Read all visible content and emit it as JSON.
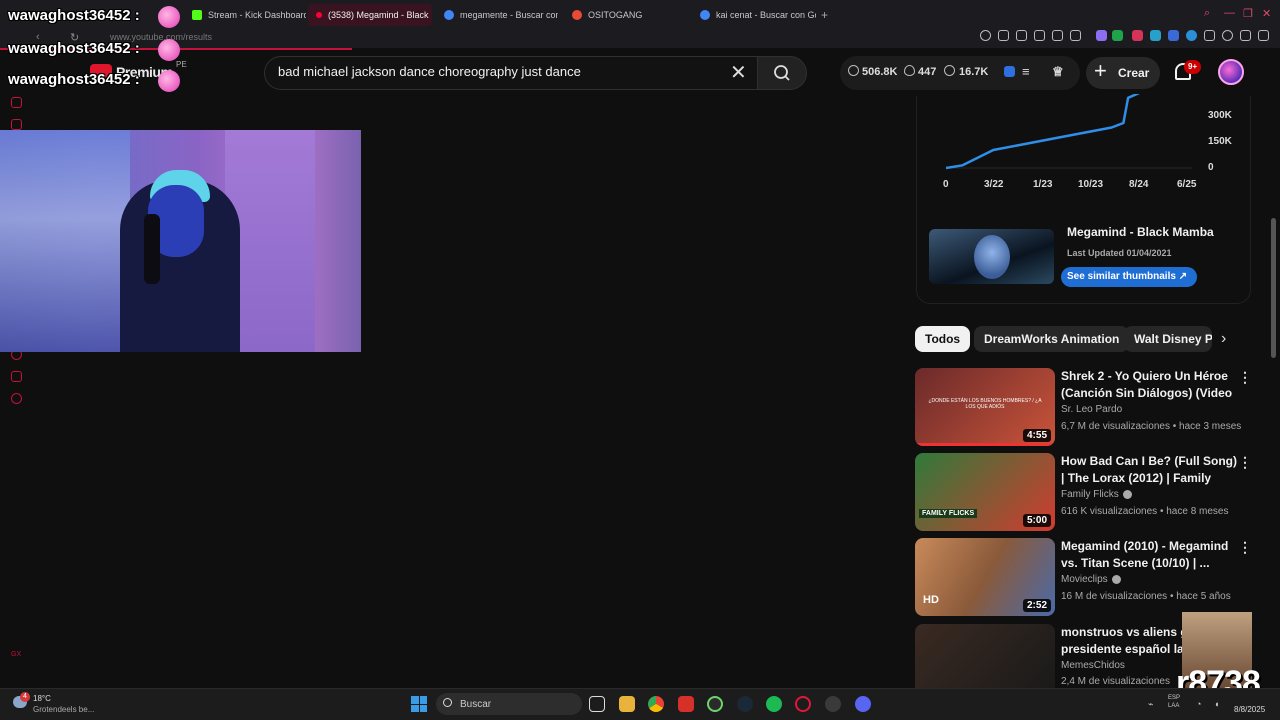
{
  "browser": {
    "tabs": [
      {
        "label": "",
        "favicon_color": "#5b5b5b"
      },
      {
        "label": "Stream - Kick Dashboard",
        "favicon_color": "#53fc18"
      },
      {
        "label": "(3538) Megamind - Black",
        "favicon_color": "#ff0033",
        "active": true
      },
      {
        "label": "megamente - Buscar con",
        "favicon_color": "#4285f4"
      },
      {
        "label": "OSITOGANG",
        "favicon_color": "#e84a3a"
      },
      {
        "label": "kai cenat - Buscar con Go",
        "favicon_color": "#4285f4"
      }
    ],
    "url": "www.youtube.com/results"
  },
  "youtube": {
    "logo_text": "Premium",
    "logo_sup": "PE",
    "search_query": "bad michael jackson dance choreography just dance",
    "stats": {
      "views": "506.8K",
      "likes": "447",
      "watch": "16.7K"
    },
    "create_label": "Crear",
    "notifications_badge": "9+"
  },
  "chat": [
    {
      "user": "wawaghost36452 :"
    },
    {
      "user": "wawaghost36452 :"
    },
    {
      "user": "wawaghost36452 :"
    }
  ],
  "chart_data": {
    "type": "line",
    "x_tick_labels": [
      "0",
      "3/22",
      "1/23",
      "10/23",
      "8/24",
      "6/25"
    ],
    "y_tick_labels": [
      "300K",
      "150K",
      "0"
    ],
    "ylim": [
      0,
      400000
    ],
    "series": [
      {
        "x": [
          0,
          0.35,
          1,
          1.6,
          2.4,
          3,
          3.5,
          3.75,
          3.85,
          4.2,
          4.6,
          5,
          5.2
        ],
        "values": [
          0,
          15000,
          100000,
          130000,
          170000,
          200000,
          225000,
          250000,
          390000,
          430000,
          460000,
          490000,
          506800
        ]
      }
    ],
    "color": "#2f8fe8"
  },
  "thumbnail_card": {
    "title": "Megamind - Black Mamba",
    "updated": "Last Updated 01/04/2021",
    "button": "See similar thumbnails ↗"
  },
  "chips": [
    "Todos",
    "DreamWorks Animation",
    "Walt Disney P"
  ],
  "videos": [
    {
      "title": "Shrek 2 - Yo Quiero Un Héroe (Canción Sin Diálogos) (Video ...",
      "channel": "Sr. Leo Pardo",
      "verified": false,
      "meta": "6,7 M de visualizaciones • hace 3 meses",
      "duration": "4:55",
      "thumb_overlay": "¿DONDE ESTÁN LOS BUENOS HOMBRES? / ¿A LOS QUE ADIÓS",
      "thumb_colors": [
        "#6b2a2a",
        "#c9543a"
      ]
    },
    {
      "title": "How Bad Can I Be? (Full Song) | The Lorax (2012) | Family Flicks",
      "channel": "Family Flicks",
      "verified": true,
      "meta": "616 K visualizaciones • hace 8 meses",
      "duration": "5:00",
      "thumb_overlay": "FAMILY FLICKS",
      "thumb_colors": [
        "#2f7a3a",
        "#d23b2f"
      ]
    },
    {
      "title": "Megamind (2010) - Megamind vs. Titan Scene (10/10) | ...",
      "channel": "Movieclips",
      "verified": true,
      "meta": "16 M de visualizaciones • hace 5 años",
      "duration": "2:52",
      "thumb_overlay": "HD",
      "thumb_colors": [
        "#c98a5a",
        "#4b6aa8"
      ]
    },
    {
      "title": "monstruos vs aliens gri presidente español latir",
      "channel": "MemesChidos",
      "verified": false,
      "meta": "2,4 M de visualizaciones",
      "duration": "",
      "thumb_overlay": "",
      "thumb_colors": [
        "#3a2a22",
        "#1a1a1a"
      ]
    }
  ],
  "overlay_watermark": "r8738",
  "taskbar": {
    "weather_temp": "18°C",
    "weather_desc": "Grotendeels be...",
    "weather_badge": "4",
    "search_label": "Buscar",
    "clock_time": "",
    "clock_date": "8/8/2025",
    "tray_lang": "ESP LAA"
  }
}
